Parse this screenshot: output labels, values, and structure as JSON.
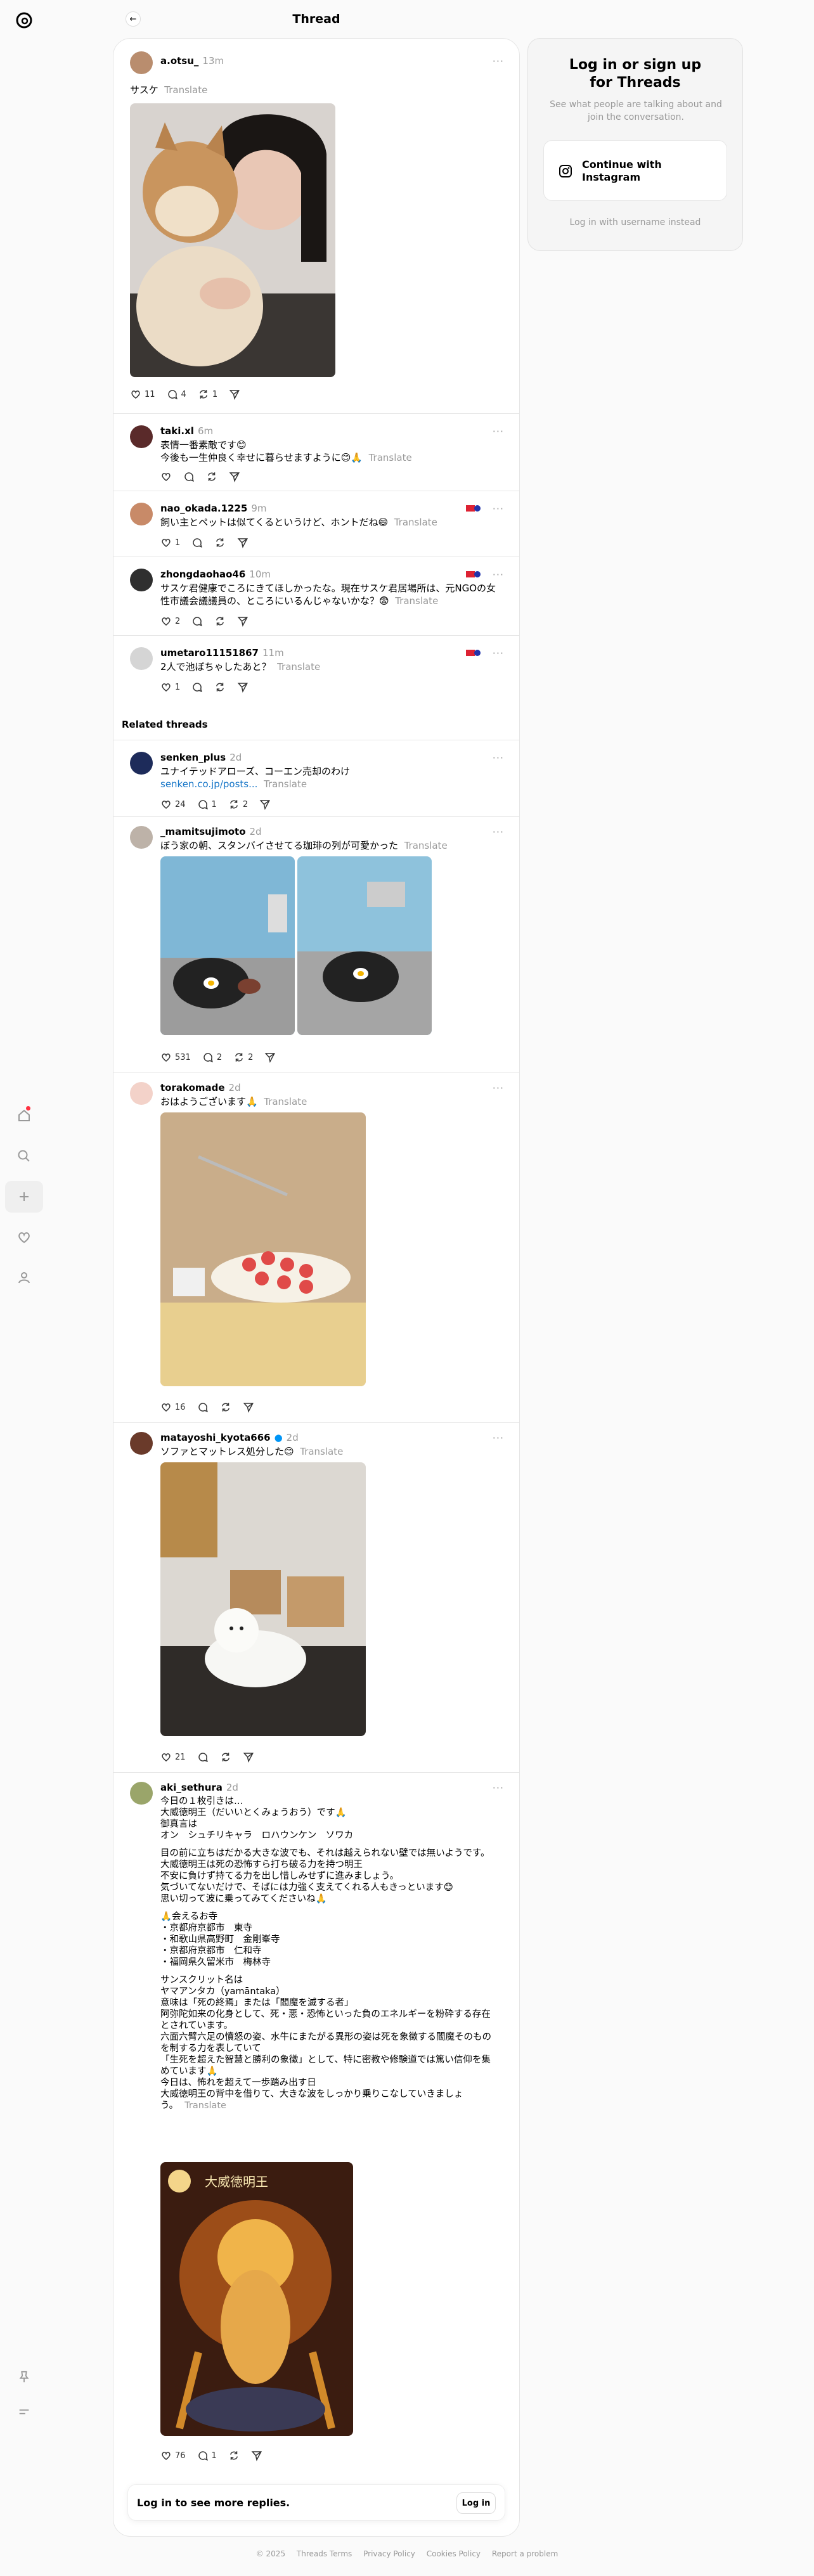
{
  "header": {
    "title": "Thread"
  },
  "login_card": {
    "title": "Log in or sign up for Threads",
    "subtitle": "See what people are talking about and join the conversation.",
    "instagram_button": "Continue with Instagram",
    "alt_login": "Log in with username instead"
  },
  "posts": [
    {
      "username": "a.otsu_",
      "time": "13m",
      "text": "サスケ",
      "translate": "Translate",
      "likes": "11",
      "replies": "4",
      "reposts": "1"
    },
    {
      "username": "taki.xl",
      "time": "6m",
      "line1": "表情一番素敵です😊",
      "line2": "今後も一生仲良く幸せに暮らせますように😊🙏",
      "translate": "Translate"
    },
    {
      "username": "nao_okada.1225",
      "time": "9m",
      "text": "飼い主とペットは似てくるというけど、ホントだね😄",
      "translate": "Translate",
      "likes": "1"
    },
    {
      "username": "zhongdaohao46",
      "time": "10m",
      "line1": "サスケ君健康でころにきてほしかったな。現在サスケ君居場所は、元NGOの女",
      "line2": "性市議会議議員の、ところにいるんじゃないかな？😨",
      "translate": "Translate",
      "likes": "2"
    },
    {
      "username": "umetaro11151867",
      "time": "11m",
      "text": "2人で池ぼちゃしたあと？",
      "translate": "Translate",
      "likes": "1"
    }
  ],
  "related_heading": "Related threads",
  "related": [
    {
      "username": "senken_plus",
      "time": "2d",
      "line1": "ユナイテッドアローズ、コーエン売却のわけ",
      "link": "senken.co.jp/posts...",
      "translate": "Translate",
      "likes": "24",
      "replies": "1",
      "reposts": "2"
    },
    {
      "username": "_mamitsujimoto",
      "time": "2d",
      "text": "ぼう家の朝、スタンバイさせてる珈琲の列が可愛かった",
      "translate": "Translate",
      "likes": "531",
      "replies": "2",
      "reposts": "2"
    },
    {
      "username": "torakomade",
      "time": "2d",
      "text": "おはようございます🙏",
      "translate": "Translate",
      "likes": "16"
    },
    {
      "username": "matayoshi_kyota666",
      "time": "2d",
      "text": "ソファとマットレス処分した😊",
      "translate": "Translate",
      "likes": "21"
    },
    {
      "username": "aki_sethura",
      "time": "2d",
      "lines": [
        "今日の１枚引きは…",
        "大威徳明王（だいいとくみょうおう）です🙏",
        "御真言は",
        "オン　シュチリキャラ　ロハウンケン　ソワカ",
        "",
        "目の前に立ちはだかる大きな波でも、それは越えられない壁では無いようです。",
        "大威徳明王は死の恐怖すら打ち破る力を持つ明王",
        "不安に負けず持てる力を出し惜しみせずに進みましょう。",
        "気づいてないだけで、そばには力強く支えてくれる人もきっといます😊",
        "思い切って波に乗ってみてくださいね🙏",
        "",
        "🙏会えるお寺",
        "・京都府京都市　東寺",
        "・和歌山県高野町　金剛峯寺",
        "・京都府京都市　仁和寺",
        "・福岡県久留米市　梅林寺",
        "",
        "サンスクリット名は",
        "ヤマアンタカ（yamāntaka）",
        "意味は「死の終焉」または「閻魔を滅する者」",
        "阿弥陀如来の化身として、死・悪・恐怖といった負のエネルギーを粉砕する存在",
        "とされています。",
        "六面六臂六足の憤怒の姿、水牛にまたがる異形の姿は死を象徴する閻魔そのもの",
        "を制する力を表していて",
        "「生死を超えた智慧と勝利の象徴」として、特に密教や修験道では篤い信仰を集",
        "めています🙏",
        "今日は、怖れを超えて一歩踏み出す日",
        "大威徳明王の背中を借りて、大きな波をしっかり乗りこなしていきましょ",
        "う。"
      ],
      "translate": "Translate",
      "image_caption": "大威徳明王",
      "likes": "76",
      "replies": "1"
    }
  ],
  "login_bar": {
    "text": "Log in to see more replies.",
    "button": "Log in"
  },
  "footer": [
    "© 2025",
    "Threads Terms",
    "Privacy Policy",
    "Cookies Policy",
    "Report a problem"
  ]
}
